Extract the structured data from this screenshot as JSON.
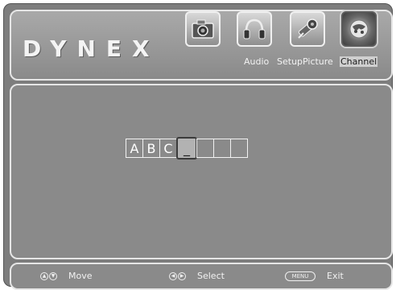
{
  "brand": {
    "logo": "DYNEX"
  },
  "menu_tabs": [
    {
      "id": "photo",
      "icon": "camera-icon",
      "label": ""
    },
    {
      "id": "audio",
      "icon": "headphones-icon",
      "label": "Audio"
    },
    {
      "id": "setup",
      "icon": "settings-icon",
      "label": "Setup"
    },
    {
      "id": "picture",
      "icon": "picture-icon",
      "label": "Picture"
    },
    {
      "id": "channel",
      "icon": "channel-icon",
      "label": "Channel",
      "active": true
    }
  ],
  "channel_name": {
    "cells": [
      "A",
      "B",
      "C",
      "_",
      "",
      "",
      ""
    ],
    "cursor_index": 3
  },
  "footer": {
    "move_label": "Move",
    "select_label": "Select",
    "menu_key": "MENU",
    "exit_label": "Exit"
  },
  "colors": {
    "panel": "#8a8a8a",
    "border": "#e6e6e6",
    "text": "#f2f2f2"
  }
}
